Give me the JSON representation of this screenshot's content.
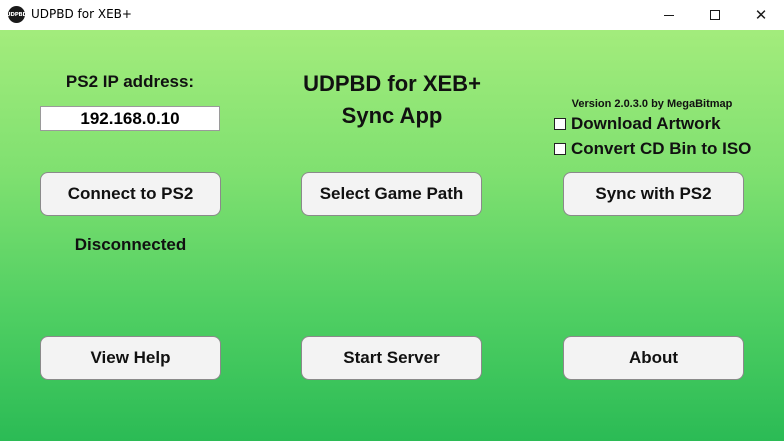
{
  "window": {
    "title": "UDPBD for XEB+",
    "icon_text": "UDPBD",
    "minimize_glyph": "minimize-icon",
    "maximize_glyph": "maximize-icon",
    "close_glyph": "✕"
  },
  "colors": {
    "gradient_top": "#a3ec7c",
    "gradient_bottom": "#2bbb55",
    "button_bg": "#f3f3f3"
  },
  "main": {
    "ip_label": "PS2 IP address:",
    "ip_value": "192.168.0.10",
    "app_title": "UDPBD for XEB+",
    "app_subtitle": "Sync App",
    "version": "Version 2.0.3.0 by MegaBitmap",
    "status": "Disconnected"
  },
  "options": {
    "download_artwork": {
      "label": "Download Artwork",
      "checked": false
    },
    "convert_cd": {
      "label": "Convert CD Bin to ISO",
      "checked": false
    }
  },
  "buttons": {
    "connect": "Connect to PS2",
    "select_path": "Select Game Path",
    "sync": "Sync with PS2",
    "help": "View Help",
    "server": "Start Server",
    "about": "About"
  }
}
